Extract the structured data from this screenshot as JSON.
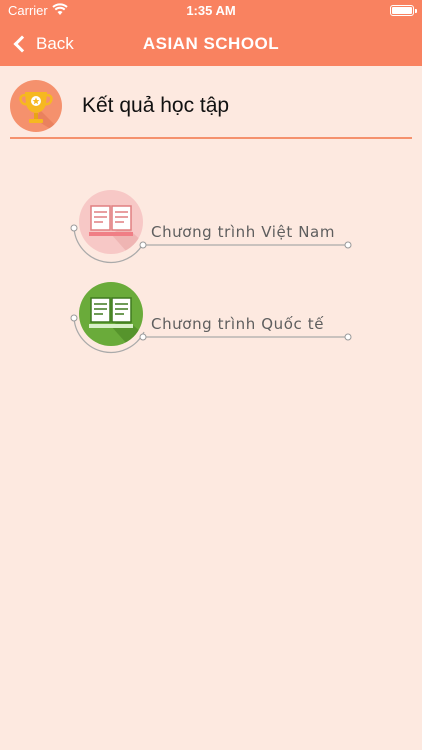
{
  "status_bar": {
    "carrier": "Carrier",
    "time": "1:35 AM"
  },
  "nav": {
    "back_label": "Back",
    "title": "ASIAN SCHOOL"
  },
  "section": {
    "title": "Kết quả học tập",
    "icon": "trophy-icon"
  },
  "menu": [
    {
      "label": "Chương trình Việt Nam",
      "icon": "open-book-icon",
      "color": "#f7c8c6"
    },
    {
      "label": "Chương trình Quốc tế",
      "icon": "book-icon",
      "color": "#6aab3a"
    }
  ],
  "colors": {
    "header": "#f98260",
    "background": "#fde9e0",
    "accent": "#f5916d"
  }
}
